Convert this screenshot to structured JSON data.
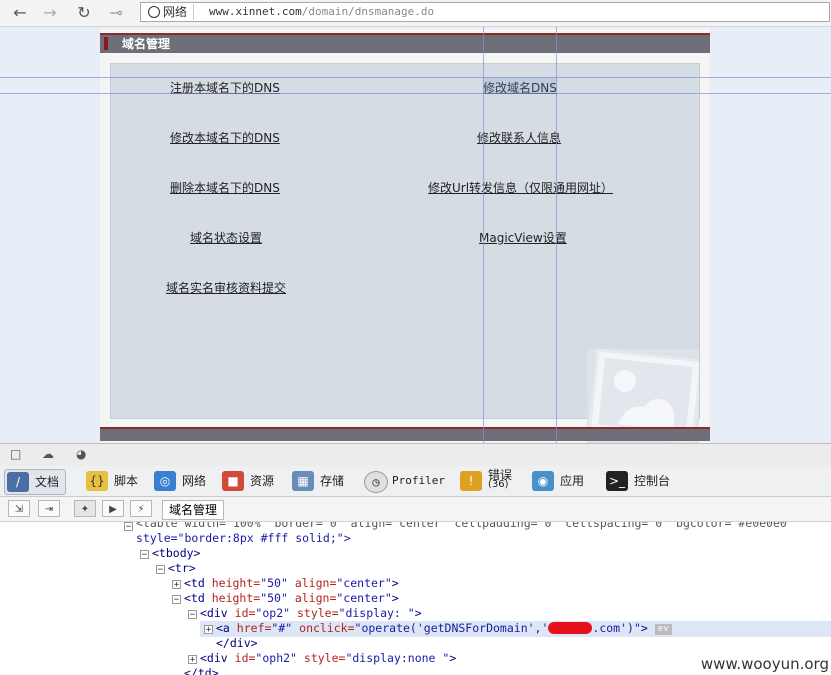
{
  "browser": {
    "site_chip_label": "网络",
    "url_domain": "www.xinnet.com",
    "url_path": "/domain/dnsmanage.do"
  },
  "page": {
    "title": "域名管理",
    "links": [
      "注册本域名下的DNS",
      "修改域名DNS",
      "修改本域名下的DNS",
      "修改联系人信息",
      "删除本域名下的DNS",
      "修改Url转发信息（仅限通用网址）",
      "域名状态设置",
      "MagicView设置",
      "域名实名审核资料提交"
    ]
  },
  "devtools": {
    "tabs": [
      {
        "label": "文档"
      },
      {
        "label": "脚本"
      },
      {
        "label": "网络"
      },
      {
        "label": "资源"
      },
      {
        "label": "存储"
      },
      {
        "label": "Profiler"
      },
      {
        "label": "错误",
        "sub": "(36)"
      },
      {
        "label": "应用"
      },
      {
        "label": "控制台"
      }
    ],
    "breadcrumb": "域名管理",
    "code_lines": {
      "l0": "<table width=\"100%\" border=\"0\" align=\"center\" cellpadding=\"0\" cellspacing=\"0\" bgcolor=\"#e0e0e0\"",
      "l1": "style=\"border:8px #fff solid;\">",
      "l2": "<tbody>",
      "l3": "<tr>",
      "l4_tag": "<td",
      "l4_a1": "height=",
      "l4_v1": "\"50\"",
      "l4_a2": "align=",
      "l4_v2": "\"center\"",
      "l4_end": ">",
      "l6_tag": "<div",
      "l6_a1": "id=",
      "l6_v1": "\"op2\"",
      "l6_a2": "style=",
      "l6_v2": "\"display: \"",
      "l6_end": ">",
      "l7_tag": "<a",
      "l7_a1": "href=",
      "l7_v1": "\"#\"",
      "l7_a2": "onclick=",
      "l7_v2a": "\"operate('getDNSForDomain','",
      "l7_v2b": ".com')\"",
      "l7_end": ">",
      "l7_badge": "ev",
      "l8": "</div>",
      "l9_tag": "<div",
      "l9_a1": "id=",
      "l9_v1": "\"oph2\"",
      "l9_a2": "style=",
      "l9_v2": "\"display:none \"",
      "l9_end": ">",
      "l10": "</td>"
    }
  },
  "watermark": "www.wooyun.org",
  "colors": {
    "header_bar": "#6e6e78",
    "accent_red": "#8a1a1a",
    "panel_bg": "#d6dce4",
    "page_bg": "#e8eef8"
  }
}
